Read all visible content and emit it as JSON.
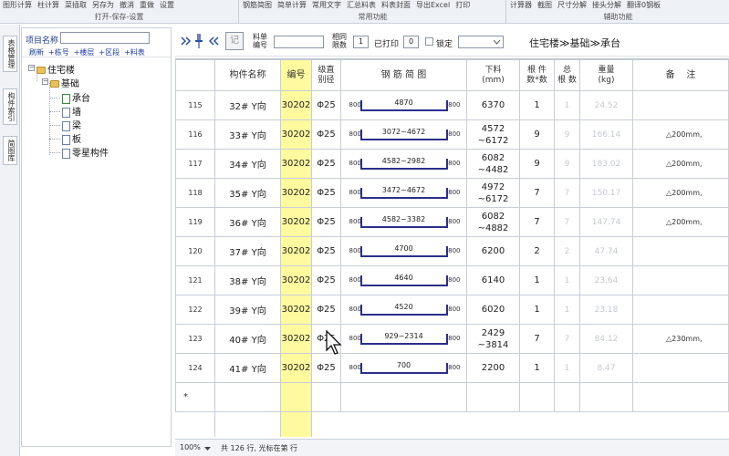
{
  "ribbon": {
    "groups": [
      {
        "buttons": [
          "图形计算",
          "柱计算",
          "菜插取",
          "另存为",
          "撤消",
          "重做",
          "设置"
        ],
        "label": "打开-保存-设置"
      },
      {
        "buttons": [
          "钢筋简图",
          "简单计算",
          "常用文字",
          "汇总料表",
          "料表封面",
          "导出Excel",
          "打印"
        ],
        "label": "常用功能"
      },
      {
        "buttons": [
          "计算器",
          "截图",
          "尺寸分解",
          "接头分解",
          "翻译0钢板"
        ],
        "label": "辅助功能"
      }
    ]
  },
  "vtabs": [
    "表格管理",
    "构件索引",
    "简图库"
  ],
  "tree": {
    "project_name_label": "项目名称",
    "links": [
      "刷新",
      "+栋号",
      "+楼层",
      "+区段",
      "+料表"
    ],
    "nodes": [
      "住宅楼",
      "基础",
      "承台",
      "墙",
      "梁",
      "板",
      "零星构件"
    ]
  },
  "toolbar": {
    "icons": [
      "double-right-icon",
      "pin-icon",
      "double-left-icon",
      "note-icon"
    ],
    "note_label": "记",
    "material_label": "料单\n编号",
    "combine_label": "相同\n限数",
    "combine_value": "1",
    "printed_label": "已打印",
    "printed_value": "0",
    "lock_label": "锁定",
    "breadcrumb": "住宅楼≫基础≫承台"
  },
  "table": {
    "headers": [
      "构件名称",
      "编号",
      "级直\n别径",
      "钢 筋 简 图",
      "下料\n(mm)",
      "根 件\n数*数",
      "总\n根 数",
      "重量\n(kg)",
      "备    注"
    ],
    "rows": [
      {
        "no": "115",
        "name": "32# Y向",
        "code": "30202",
        "grade": "Φ25",
        "left": "800",
        "shape": "4870",
        "right": "800",
        "cut": "6370",
        "count": "1",
        "total": "1",
        "weight": "24.52",
        "note": ""
      },
      {
        "no": "116",
        "name": "33# Y向",
        "code": "30202",
        "grade": "Φ25",
        "left": "800",
        "shape": "3072~4672",
        "right": "800",
        "cut": "4572\n~6172",
        "count": "9",
        "total": "9",
        "weight": "166.14",
        "note": "△200mm,"
      },
      {
        "no": "117",
        "name": "34# Y向",
        "code": "30202",
        "grade": "Φ25",
        "left": "800",
        "shape": "4582~2982",
        "right": "800",
        "cut": "6082\n~4482",
        "count": "9",
        "total": "9",
        "weight": "183.02",
        "note": "△200mm,"
      },
      {
        "no": "118",
        "name": "35# Y向",
        "code": "30202",
        "grade": "Φ25",
        "left": "800",
        "shape": "3472~4672",
        "right": "800",
        "cut": "4972\n~6172",
        "count": "7",
        "total": "7",
        "weight": "150.17",
        "note": "△200mm,"
      },
      {
        "no": "119",
        "name": "36# Y向",
        "code": "30202",
        "grade": "Φ25",
        "left": "800",
        "shape": "4582~3382",
        "right": "800",
        "cut": "6082\n~4882",
        "count": "7",
        "total": "7",
        "weight": "147.74",
        "note": "△200mm,"
      },
      {
        "no": "120",
        "name": "37# Y向",
        "code": "30202",
        "grade": "Φ25",
        "left": "800",
        "shape": "4700",
        "right": "800",
        "cut": "6200",
        "count": "2",
        "total": "2",
        "weight": "47.74",
        "note": ""
      },
      {
        "no": "121",
        "name": "38# Y向",
        "code": "30202",
        "grade": "Φ25",
        "left": "800",
        "shape": "4640",
        "right": "800",
        "cut": "6140",
        "count": "1",
        "total": "1",
        "weight": "23.64",
        "note": ""
      },
      {
        "no": "122",
        "name": "39# Y向",
        "code": "30202",
        "grade": "Φ25",
        "left": "800",
        "shape": "4520",
        "right": "800",
        "cut": "6020",
        "count": "1",
        "total": "1",
        "weight": "23.18",
        "note": ""
      },
      {
        "no": "123",
        "name": "40# Y向",
        "code": "30202",
        "grade": "Φ25",
        "left": "800",
        "shape": "929~2314",
        "right": "800",
        "cut": "2429\n~3814",
        "count": "7",
        "total": "7",
        "weight": "84.12",
        "note": "△230mm,"
      },
      {
        "no": "124",
        "name": "41# Y向",
        "code": "30202",
        "grade": "Φ25",
        "left": "800",
        "shape": "700",
        "right": "800",
        "cut": "2200",
        "count": "1",
        "total": "1",
        "weight": "8.47",
        "note": ""
      }
    ],
    "new_row_marker": "*"
  },
  "status": {
    "zoom": "100%",
    "info": "共 126 行, 光标在第  行"
  }
}
